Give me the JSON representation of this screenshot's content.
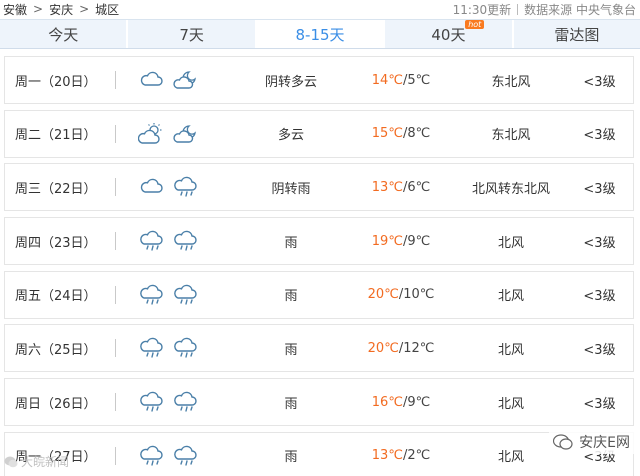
{
  "breadcrumb": {
    "province": "安徽",
    "city": "安庆",
    "district": "城区",
    "separator": ">"
  },
  "meta": {
    "update": "11:30更新",
    "source": "数据来源 中央气象台"
  },
  "tabs": [
    {
      "label": "今天"
    },
    {
      "label": "7天"
    },
    {
      "label": "8-15天"
    },
    {
      "label": "40天",
      "badge": "hot"
    },
    {
      "label": "雷达图"
    }
  ],
  "active_tab": "8-15天",
  "days": [
    {
      "day": "周一（20日）",
      "icon_day": "cloudy-icon",
      "icon_night": "cloud-moon-icon",
      "desc": "阴转多云",
      "high": "14℃",
      "low": "/5℃",
      "wind": "东北风",
      "level": "<3级"
    },
    {
      "day": "周二（21日）",
      "icon_day": "partly-cloudy-icon",
      "icon_night": "cloud-moon-icon",
      "desc": "多云",
      "high": "15℃",
      "low": "/8℃",
      "wind": "东北风",
      "level": "<3级"
    },
    {
      "day": "周三（22日）",
      "icon_day": "cloudy-icon",
      "icon_night": "rain-icon",
      "desc": "阴转雨",
      "high": "13℃",
      "low": "/6℃",
      "wind": "北风转东北风",
      "level": "<3级"
    },
    {
      "day": "周四（23日）",
      "icon_day": "rain-icon",
      "icon_night": "rain-icon",
      "desc": "雨",
      "high": "19℃",
      "low": "/9℃",
      "wind": "北风",
      "level": "<3级"
    },
    {
      "day": "周五（24日）",
      "icon_day": "rain-icon",
      "icon_night": "rain-icon",
      "desc": "雨",
      "high": "20℃",
      "low": "/10℃",
      "wind": "北风",
      "level": "<3级"
    },
    {
      "day": "周六（25日）",
      "icon_day": "rain-icon",
      "icon_night": "rain-icon",
      "desc": "雨",
      "high": "20℃",
      "low": "/12℃",
      "wind": "北风",
      "level": "<3级"
    },
    {
      "day": "周日（26日）",
      "icon_day": "rain-icon",
      "icon_night": "rain-icon",
      "desc": "雨",
      "high": "16℃",
      "low": "/9℃",
      "wind": "北风",
      "level": "<3级"
    },
    {
      "day": "周一（27日）",
      "icon_day": "rain-icon",
      "icon_night": "rain-icon",
      "desc": "雨",
      "high": "13℃",
      "low": "/2℃",
      "wind": "北风",
      "level": "<3级"
    }
  ],
  "watermarks": {
    "left": "大皖新闻",
    "right": "安庆E网"
  },
  "colors": {
    "active_tab": "#3a8ee6",
    "high_temp": "#f26b21",
    "tab_bg": "#eef4fb",
    "hot_badge": "#f97a1f"
  }
}
